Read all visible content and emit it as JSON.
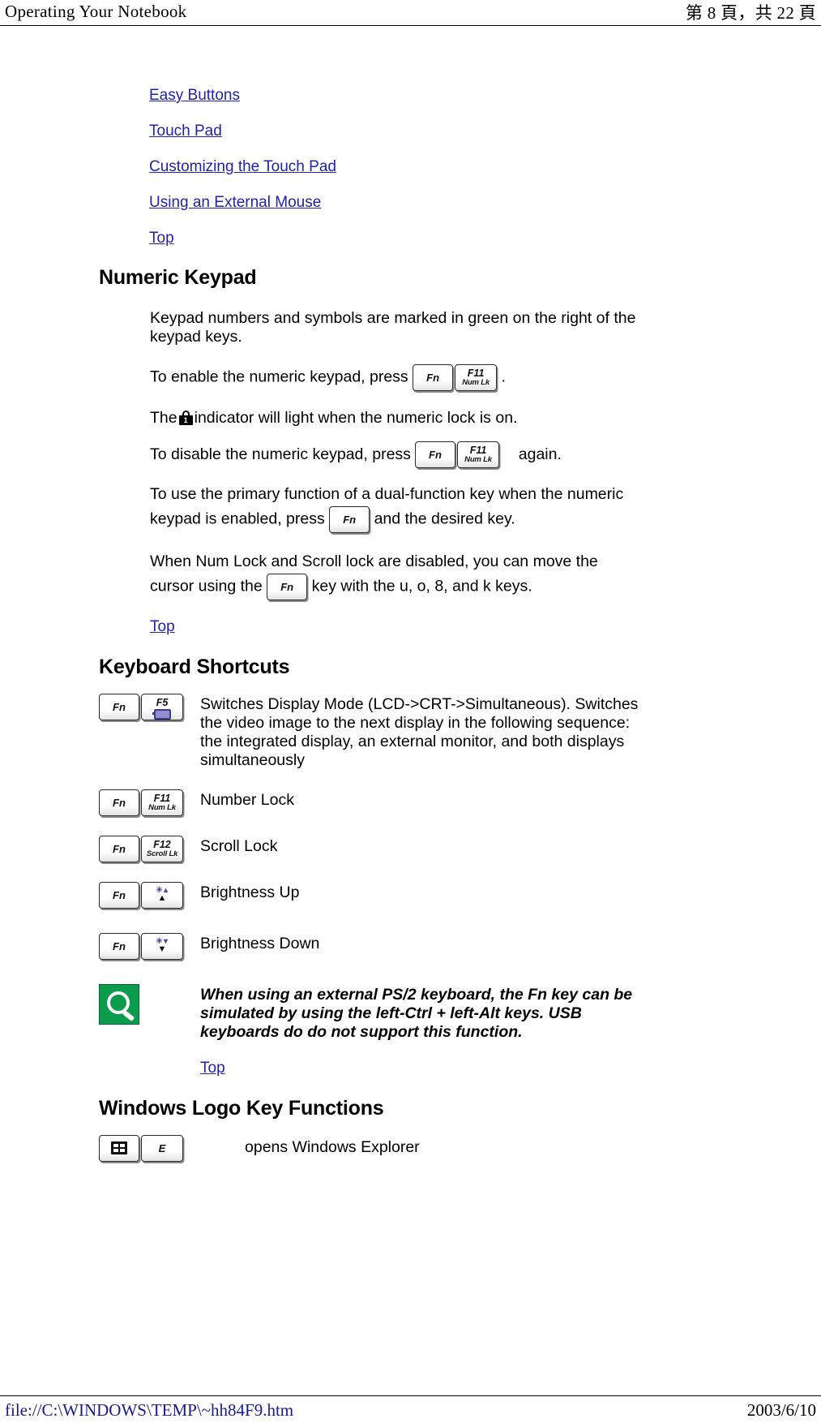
{
  "header": {
    "title": "Operating Your Notebook",
    "page_indicator": "第 8 頁，共 22 頁"
  },
  "footer": {
    "file_path": "file://C:\\WINDOWS\\TEMP\\~hh84F9.htm",
    "date": "2003/6/10"
  },
  "toc": {
    "items": [
      {
        "label": "Easy Buttons"
      },
      {
        "label": "Touch Pad"
      },
      {
        "label": "Customizing the Touch Pad"
      },
      {
        "label": "Using an External Mouse"
      },
      {
        "label": "Top"
      }
    ]
  },
  "numeric_keypad": {
    "heading": "Numeric Keypad",
    "p1": "Keypad numbers and symbols are marked in green on the right of the keypad keys.",
    "p2_before": "To enable the numeric keypad, press",
    "p2_after": ".",
    "p3_before": "The",
    "p3_after": "indicator will light when the numeric lock is on.",
    "p4_before": "To disable the numeric keypad, press",
    "p4_after": "again.",
    "p5_before": "To use the primary function of a dual-function key when the numeric keypad is enabled, press",
    "p5_after": "and the desired key.",
    "p6_before": "When Num Lock and Scroll lock are disabled, you can move the cursor using the",
    "p6_after": "key with the u, o, 8, and k keys.",
    "top_link": "Top"
  },
  "keys": {
    "fn": "Fn",
    "f5_top": "F5",
    "f11_top": "F11",
    "f11_bot": "Num Lk",
    "f12_top": "F12",
    "f12_bot": "Scroll Lk",
    "lock_indicator_label": "1",
    "e_key": "E"
  },
  "keyboard_shortcuts": {
    "heading": "Keyboard Shortcuts",
    "rows": [
      {
        "key_combo": "Fn + F5",
        "description": "Switches Display Mode (LCD->CRT->Simultaneous). Switches the video image to the next display in the following sequence: the integrated display, an external monitor, and both displays simultaneously"
      },
      {
        "key_combo": "Fn + F11 (Num Lk)",
        "description": "Number Lock"
      },
      {
        "key_combo": "Fn + F12 (Scroll Lk)",
        "description": "Scroll Lock"
      },
      {
        "key_combo": "Fn + Brightness Up",
        "description": "Brightness Up"
      },
      {
        "key_combo": "Fn + Brightness Down",
        "description": "Brightness Down"
      }
    ],
    "note": "When using an external PS/2 keyboard, the Fn key can be simulated by using the left-Ctrl + left-Alt keys. USB keyboards do do not support this function.",
    "top_link": "Top"
  },
  "windows_logo": {
    "heading": "Windows Logo Key Functions",
    "rows": [
      {
        "key_combo": "Windows Logo + E",
        "description": "opens Windows Explorer"
      }
    ]
  },
  "colors": {
    "link": "#2222aa",
    "text": "#000000",
    "note_icon_bg": "#0a9b4c",
    "background": "#ffffff"
  }
}
